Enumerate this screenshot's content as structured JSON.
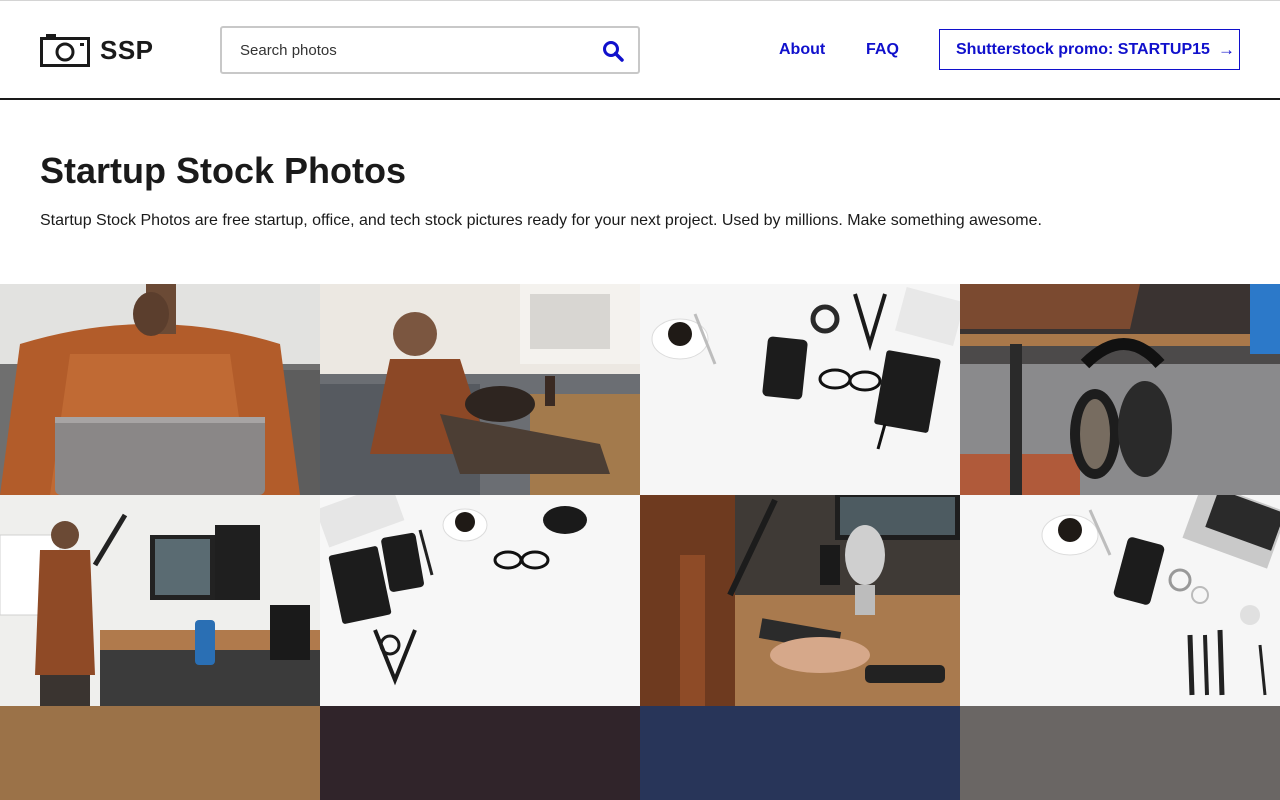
{
  "header": {
    "logo_text": "SSP",
    "search": {
      "placeholder": "Search photos",
      "value": ""
    },
    "nav": {
      "about": "About",
      "faq": "FAQ"
    },
    "promo": {
      "label": "Shutterstock promo: STARTUP15",
      "arrow": "→"
    }
  },
  "hero": {
    "title": "Startup Stock Photos",
    "description": "Startup Stock Photos are free startup, office, and tech stock pictures ready for your next project. Used by millions. Make something awesome."
  },
  "colors": {
    "link": "#1010cc",
    "text": "#1a1a1a",
    "placeholder_tiles": [
      "#9b7248",
      "#30242a",
      "#283559",
      "#6a6664"
    ]
  },
  "photos": [
    {
      "subject": "man in plaid shirt with laptop on couch"
    },
    {
      "subject": "man on sofa with dog and phone"
    },
    {
      "subject": "desk flatlay: coffee, phone, scissors, glasses, notebook"
    },
    {
      "subject": "headphones hanging under desk"
    },
    {
      "subject": "man standing at computer desk"
    },
    {
      "subject": "flatlay: keyboard, notebook, phone, pen, coffee, clock"
    },
    {
      "subject": "hands on keyboard with microphone"
    },
    {
      "subject": "flatlay: coffee, phone, earrings, makeup brushes"
    }
  ],
  "icons": {
    "logo": "camera-icon",
    "search": "search-icon",
    "promo_arrow": "arrow-right-icon"
  }
}
